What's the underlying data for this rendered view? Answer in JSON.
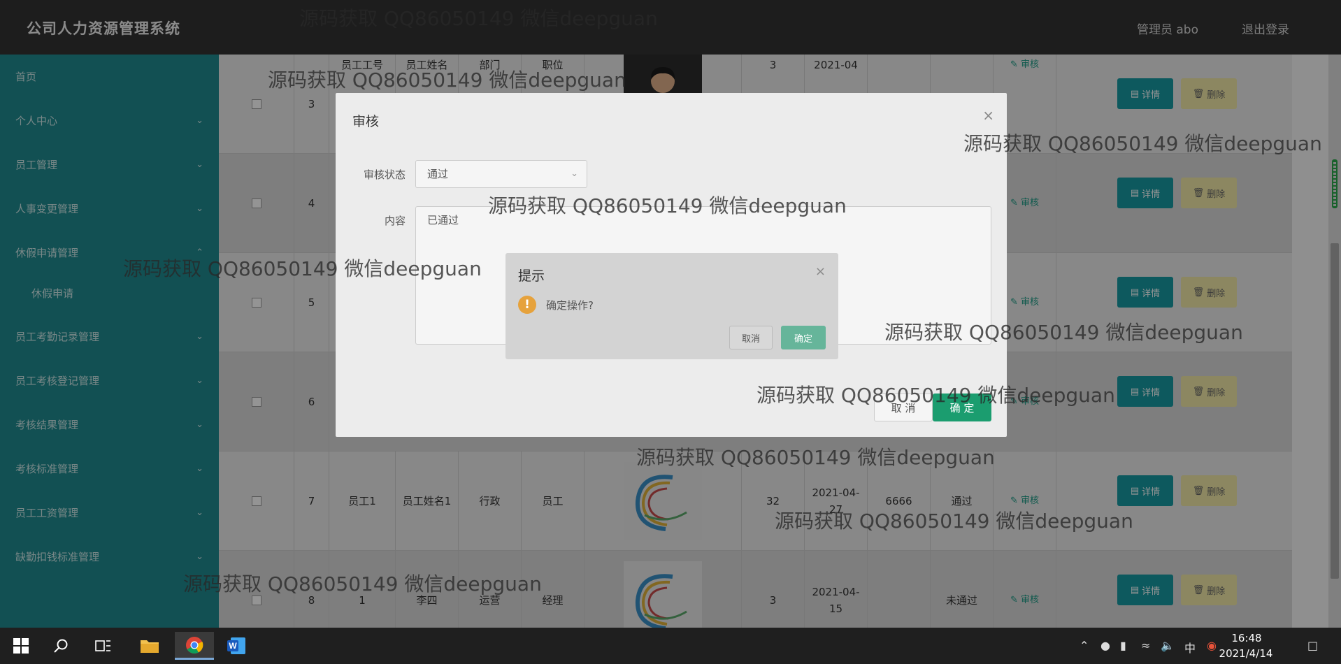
{
  "header": {
    "app_title": "公司人力资源管理系统",
    "admin_label": "管理员 abo",
    "logout": "退出登录"
  },
  "sidebar": {
    "items": [
      {
        "label": "首页",
        "expandable": false
      },
      {
        "label": "个人中心",
        "expandable": true
      },
      {
        "label": "员工管理",
        "expandable": true
      },
      {
        "label": "人事变更管理",
        "expandable": true
      },
      {
        "label": "休假申请管理",
        "expandable": true
      },
      {
        "label": "休假申请",
        "expandable": false
      },
      {
        "label": "员工考勤记录管理",
        "expandable": true
      },
      {
        "label": "员工考核登记管理",
        "expandable": true
      },
      {
        "label": "考核结果管理",
        "expandable": true
      },
      {
        "label": "考核标准管理",
        "expandable": true
      },
      {
        "label": "员工工资管理",
        "expandable": true
      },
      {
        "label": "缺勤扣钱标准管理",
        "expandable": true
      }
    ]
  },
  "table": {
    "rows": [
      {
        "index": "3",
        "emp_no": "",
        "name": "",
        "dept": "",
        "post": "",
        "photo": "person",
        "days": "3",
        "date": "2021-04",
        "amount": "",
        "status": "",
        "audit": "审核",
        "detail": "详情",
        "delete": "删除"
      },
      {
        "index": "4",
        "emp_no": "",
        "name": "",
        "dept": "",
        "post": "",
        "photo": "",
        "days": "",
        "date": "",
        "amount": "",
        "status": "",
        "audit": "审核",
        "detail": "详情",
        "delete": "删除"
      },
      {
        "index": "5",
        "emp_no": "",
        "name": "",
        "dept": "",
        "post": "",
        "photo": "",
        "days": "",
        "date": "",
        "amount": "",
        "status": "",
        "audit": "审核",
        "detail": "详情",
        "delete": "删除"
      },
      {
        "index": "6",
        "emp_no": "",
        "name": "",
        "dept": "",
        "post": "",
        "photo": "",
        "days": "",
        "date": "",
        "amount": "",
        "status": "",
        "audit": "审核",
        "detail": "详情",
        "delete": "删除"
      },
      {
        "index": "7",
        "emp_no": "员工1",
        "name": "员工姓名1",
        "dept": "行政",
        "post": "员工",
        "photo": "logo",
        "days": "32",
        "date": "2021-04-27",
        "amount": "6666",
        "status": "通过",
        "audit": "审核",
        "detail": "详情",
        "delete": "删除"
      },
      {
        "index": "8",
        "emp_no": "1",
        "name": "李四",
        "dept": "运营",
        "post": "经理",
        "photo": "logo",
        "days": "3",
        "date": "2021-04-15",
        "amount": "",
        "status": "未通过",
        "audit": "审核",
        "detail": "详情",
        "delete": "删除"
      }
    ],
    "partial_header": {
      "emp_no": "员工工号",
      "name": "员工姓名",
      "dept": "部门",
      "post": "职位"
    }
  },
  "audit_dialog": {
    "title": "审核",
    "status_label": "审核状态",
    "status_value": "通过",
    "content_label": "内容",
    "content_value": "已通过",
    "cancel": "取 消",
    "ok": "确 定"
  },
  "confirm_dialog": {
    "title": "提示",
    "message": "确定操作?",
    "cancel": "取消",
    "ok": "确定"
  },
  "watermark_text": "源码获取 QQ86050149 微信deepguan",
  "taskbar": {
    "time": "16:48",
    "date": "2021/4/14",
    "ime": "中"
  },
  "colors": {
    "sidebar": "#1f8a8f",
    "header": "#333333",
    "detail_button": "#179aa3",
    "delete_button": "#f1e9a8",
    "ok_button": "#1b9d6f"
  }
}
